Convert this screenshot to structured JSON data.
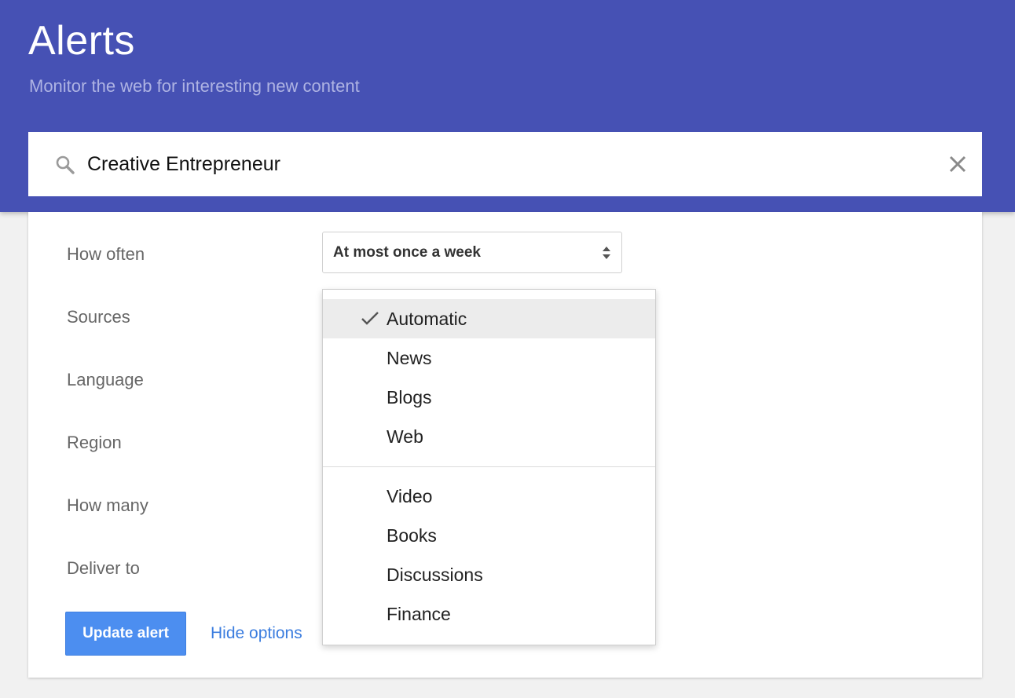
{
  "header": {
    "title": "Alerts",
    "subtitle": "Monitor the web for interesting new content"
  },
  "search": {
    "value": "Creative Entrepreneur",
    "icon": "search-icon",
    "clear_icon": "close-icon"
  },
  "options": {
    "labels": [
      "How often",
      "Sources",
      "Language",
      "Region",
      "How many",
      "Deliver to"
    ],
    "how_often_selected": "At most once a week"
  },
  "actions": {
    "update_label": "Update alert",
    "hide_options_label": "Hide options"
  },
  "sources_dropdown": {
    "selected": "Automatic",
    "group1": [
      "Automatic",
      "News",
      "Blogs",
      "Web"
    ],
    "group2": [
      "Video",
      "Books",
      "Discussions",
      "Finance"
    ]
  },
  "colors": {
    "header_bg": "#4651b4",
    "button_bg": "#4c8ef0",
    "link": "#3b7ddf"
  }
}
